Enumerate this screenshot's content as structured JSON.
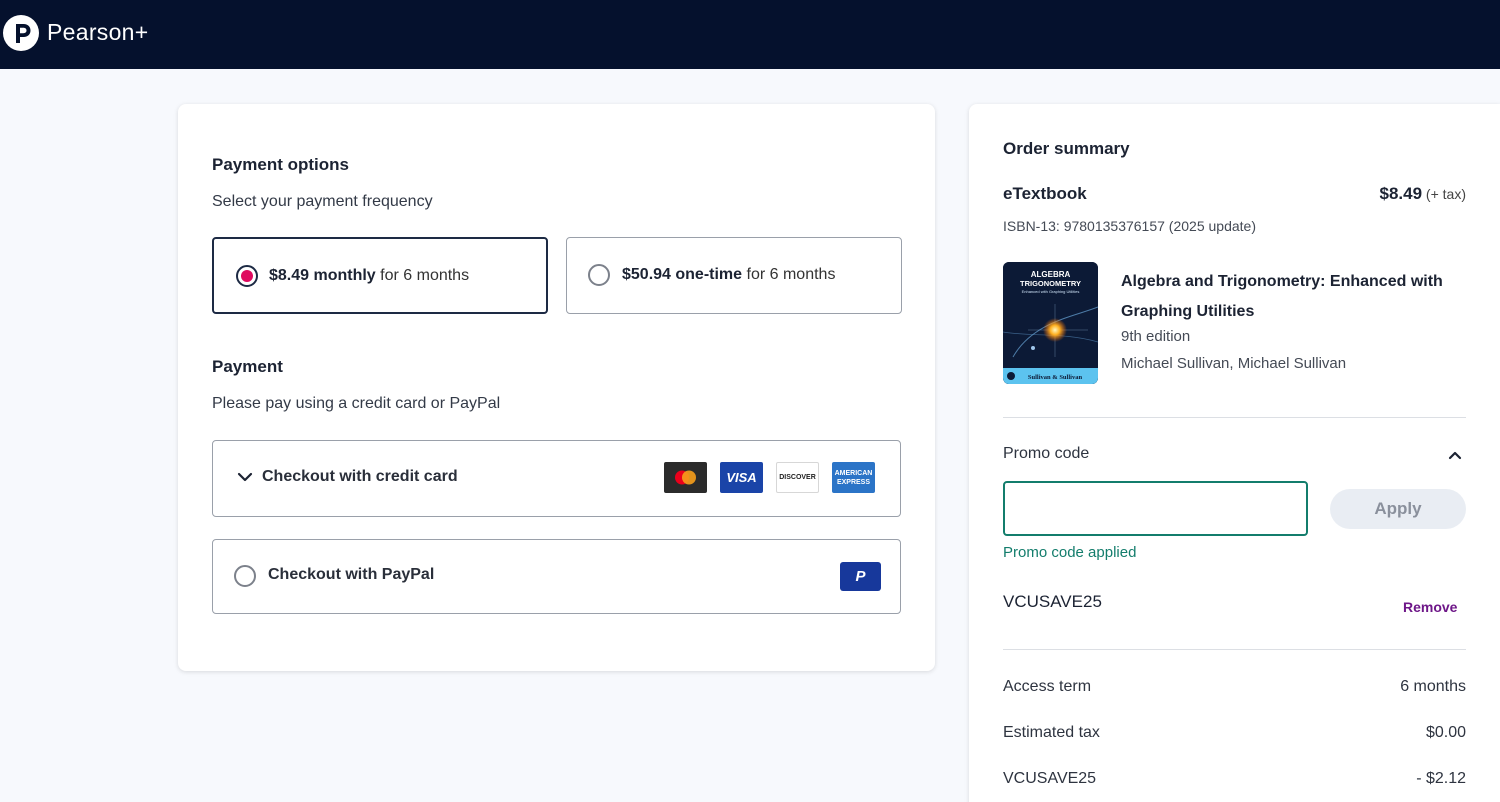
{
  "header": {
    "brand": "Pearson+"
  },
  "payment_options": {
    "title": "Payment options",
    "subtitle": "Select your payment frequency",
    "options": [
      {
        "price": "$8.49 monthly",
        "term": " for 6 months",
        "selected": true
      },
      {
        "price": "$50.94 one-time",
        "term": " for 6 months",
        "selected": false
      }
    ]
  },
  "payment": {
    "title": "Payment",
    "subtitle": "Please pay using a credit card or PayPal",
    "credit_card_label": "Checkout with credit card",
    "paypal_label": "Checkout with PayPal",
    "card_brands": [
      "mastercard-icon",
      "visa-icon",
      "discover-icon",
      "amex-icon"
    ],
    "visa_text": "VISA",
    "discover_text": "DISCOVER",
    "amex_text": "AMERICAN EXPRESS",
    "paypal_text": "P"
  },
  "order_summary": {
    "title": "Order summary",
    "product_type": "eTextbook",
    "price": "$8.49",
    "tax_note": " (+ tax)",
    "isbn": "ISBN-13: 9780135376157 (2025 update)",
    "book": {
      "title": "Algebra and Trigonometry: Enhanced with Graphing Utilities",
      "edition": "9th edition",
      "authors": "Michael Sullivan, Michael Sullivan",
      "cover_title_1": "ALGEBRA",
      "cover_title_2": "TRIGONOMETRY",
      "cover_subtitle": "Enhanced with Graphing Utilities",
      "cover_authors": "Sullivan & Sullivan"
    },
    "promo": {
      "label": "Promo code",
      "input_value": "",
      "apply_label": "Apply",
      "applied_message": "Promo code applied",
      "code": "VCUSAVE25",
      "remove_label": "Remove"
    },
    "rows": [
      {
        "label": "Access term",
        "value": "6 months"
      },
      {
        "label": "Estimated tax",
        "value": "$0.00"
      },
      {
        "label": "VCUSAVE25",
        "value": "- $2.12"
      }
    ]
  },
  "colors": {
    "header_bg": "#05112d",
    "radio_selected": "#df0a5f",
    "promo_green": "#137d6c",
    "remove_purple": "#6e1788"
  }
}
